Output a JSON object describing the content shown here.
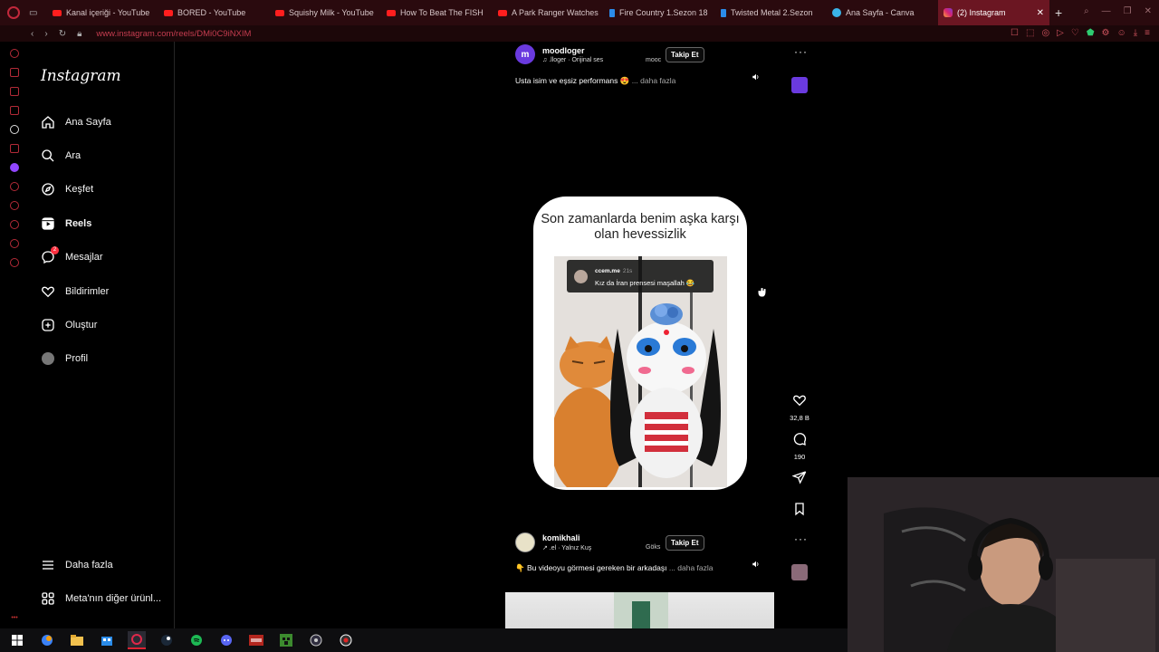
{
  "browser": {
    "tabs": [
      {
        "label": "Kanal içeriği - YouTube",
        "icon": "youtube-icon",
        "active": false
      },
      {
        "label": "BORED - YouTube",
        "icon": "youtube-icon",
        "active": false
      },
      {
        "label": "Squishy Milk - YouTube",
        "icon": "youtube-icon",
        "active": false
      },
      {
        "label": "How To Beat The FISH",
        "icon": "youtube-icon",
        "active": false
      },
      {
        "label": "A Park Ranger Watches",
        "icon": "youtube-icon",
        "active": false
      },
      {
        "label": "Fire Country 1.Sezon 18",
        "icon": "tv-icon",
        "active": false
      },
      {
        "label": "Twisted Metal 2.Sezon",
        "icon": "tv-icon",
        "active": false
      },
      {
        "label": "Ana Sayfa - Canva",
        "icon": "canva-icon",
        "active": false
      },
      {
        "label": "(2) Instagram",
        "icon": "instagram-icon",
        "active": true
      }
    ],
    "url": "www.instagram.com/reels/DMi0C9iNXIM",
    "accent_color": "#c1283b"
  },
  "sidebar": {
    "logo": "Instagram",
    "items": [
      {
        "label": "Ana Sayfa",
        "icon": "home-icon"
      },
      {
        "label": "Ara",
        "icon": "search-icon"
      },
      {
        "label": "Keşfet",
        "icon": "explore-icon"
      },
      {
        "label": "Reels",
        "icon": "reels-icon",
        "active": true
      },
      {
        "label": "Mesajlar",
        "icon": "messages-icon",
        "badge": "2"
      },
      {
        "label": "Bildirimler",
        "icon": "heart-icon"
      },
      {
        "label": "Oluştur",
        "icon": "create-icon"
      },
      {
        "label": "Profil",
        "icon": "avatar-icon"
      }
    ],
    "more": {
      "label": "Daha fazla",
      "icon": "menu-icon"
    },
    "meta": {
      "label": "Meta'nın diğer ürünl...",
      "icon": "meta-icon"
    }
  },
  "reel_top": {
    "username": "moodloger",
    "audio": "♫ .lloger · Orijinal ses",
    "extra": "mooc",
    "follow": "Takip Et",
    "caption": "Usta isim ve eşsiz performans 😍",
    "more": "... daha fazla"
  },
  "reel_main": {
    "title": "Son zamanlarda benim aşka karşı olan hevessizlik",
    "comment_user": "ccem.me",
    "comment_time": "21s",
    "comment_text": "Kız da İran prensesi maşallah 😂",
    "likes": "32,8 B",
    "comments": "190"
  },
  "reel_bottom": {
    "username": "komikhali",
    "audio": "↗ .el · Yalnız Kuş",
    "extra": "Göks",
    "follow": "Takip Et",
    "caption": "👇 Bu videoyu görmesi gereken bir arkadaşı",
    "more": "... daha fazla"
  }
}
